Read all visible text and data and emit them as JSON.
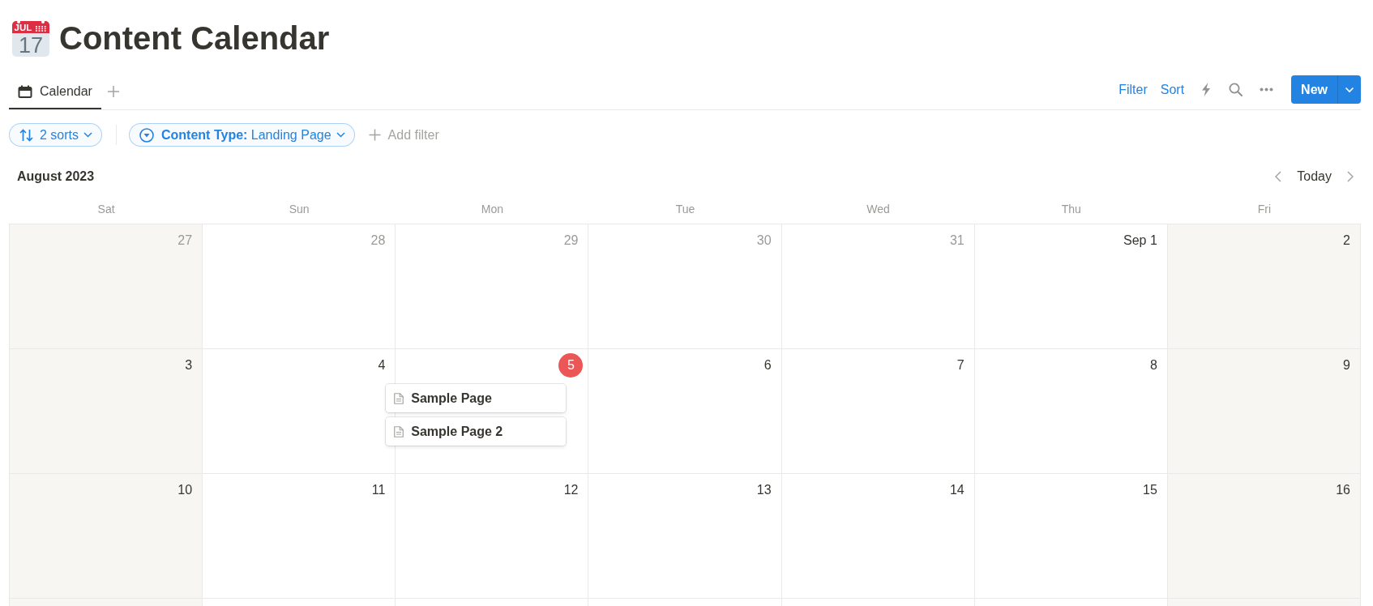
{
  "page": {
    "icon": {
      "month": "JUL",
      "day": "17"
    },
    "title": "Content Calendar"
  },
  "view_bar": {
    "tabs": [
      {
        "label": "Calendar",
        "selected": true
      }
    ],
    "filter_button": "Filter",
    "sort_button": "Sort",
    "new_button": "New"
  },
  "filter_bar": {
    "sorts": "2 sorts",
    "filters": [
      {
        "text": "**Content Type:** Landing Page"
      }
    ],
    "add_filter": "Add filter"
  },
  "calendar": {
    "month": "August 2023",
    "today_button": "Today",
    "weekdays": [
      {
        "label": "Sat",
        "kind": "weekend"
      },
      {
        "label": "Sun",
        "kind": "weekday"
      },
      {
        "label": "Mon",
        "kind": "weekday"
      },
      {
        "label": "Tue",
        "kind": "weekday"
      },
      {
        "label": "Wed",
        "kind": "weekday"
      },
      {
        "label": "Thu",
        "kind": "weekday"
      },
      {
        "label": "Fri",
        "kind": "weekend"
      }
    ],
    "weeks": [
      {
        "days": [
          {
            "date": "27",
            "muted": true,
            "today": false
          },
          {
            "date": "28",
            "muted": true,
            "today": false
          },
          {
            "date": "29",
            "muted": true,
            "today": false
          },
          {
            "date": "30",
            "muted": true,
            "today": false
          },
          {
            "date": "31",
            "muted": true,
            "today": false
          },
          {
            "date": "Sep 1",
            "muted": false,
            "today": false
          },
          {
            "date": "2",
            "muted": false,
            "today": false
          }
        ]
      },
      {
        "days": [
          {
            "date": "3",
            "muted": false,
            "today": false
          },
          {
            "date": "4",
            "muted": false,
            "today": false
          },
          {
            "date": "5",
            "muted": false,
            "today": true,
            "events": [
              {
                "title": "Sample Page"
              },
              {
                "title": "Sample Page 2"
              }
            ]
          },
          {
            "date": "6",
            "muted": false,
            "today": false
          },
          {
            "date": "7",
            "muted": false,
            "today": false
          },
          {
            "date": "8",
            "muted": false,
            "today": false
          },
          {
            "date": "9",
            "muted": false,
            "today": false
          }
        ]
      },
      {
        "days": [
          {
            "date": "10",
            "muted": false,
            "today": false
          },
          {
            "date": "11",
            "muted": false,
            "today": false
          },
          {
            "date": "12",
            "muted": false,
            "today": false
          },
          {
            "date": "13",
            "muted": false,
            "today": false
          },
          {
            "date": "14",
            "muted": false,
            "today": false
          },
          {
            "date": "15",
            "muted": false,
            "today": false
          },
          {
            "date": "16",
            "muted": false,
            "today": false
          }
        ]
      }
    ]
  }
}
